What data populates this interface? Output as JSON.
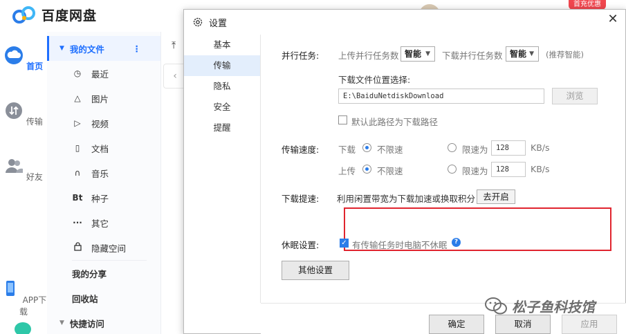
{
  "app": {
    "title": "百度网盘",
    "promo_badge": "首充优惠",
    "rail": [
      {
        "label": "首页",
        "icon": "cloud-icon",
        "active": true
      },
      {
        "label": "传输",
        "icon": "transfer-icon",
        "active": false
      },
      {
        "label": "好友",
        "icon": "friends-icon",
        "active": false
      },
      {
        "label": "APP下载",
        "icon": "phone-icon",
        "active": false
      }
    ],
    "nav": {
      "my_files": "我的文件",
      "items": [
        {
          "label": "最近",
          "icon": "clock-icon",
          "glyph": "◷"
        },
        {
          "label": "图片",
          "icon": "image-icon",
          "glyph": "△"
        },
        {
          "label": "视频",
          "icon": "video-icon",
          "glyph": "▷"
        },
        {
          "label": "文档",
          "icon": "document-icon",
          "glyph": "▯"
        },
        {
          "label": "音乐",
          "icon": "headphones-icon",
          "glyph": "∩"
        },
        {
          "label": "种子",
          "icon": "bt-icon",
          "glyph": "Bt"
        },
        {
          "label": "其它",
          "icon": "more-icon",
          "glyph": "···"
        },
        {
          "label": "隐藏空间",
          "icon": "lock-icon",
          "glyph": "🔒"
        }
      ],
      "my_share": "我的分享",
      "recycle": "回收站",
      "quick_access": "快捷访问"
    }
  },
  "dialog": {
    "title": "设置",
    "side_items": [
      {
        "label": "基本",
        "active": false
      },
      {
        "label": "传输",
        "active": true
      },
      {
        "label": "隐私",
        "active": false
      },
      {
        "label": "安全",
        "active": false
      },
      {
        "label": "提醒",
        "active": false
      }
    ],
    "parallel": {
      "label": "并行任务:",
      "upload_label": "上传并行任务数",
      "upload_value": "智能",
      "download_label": "下载并行任务数",
      "download_value": "智能",
      "hint": "(推荐智能)"
    },
    "download_location": {
      "label": "下载文件位置选择:",
      "path": "E:\\BaiduNetdiskDownload",
      "browse": "浏览",
      "default_checkbox": "默认此路径为下载路径",
      "default_checked": false
    },
    "speed": {
      "label": "传输速度:",
      "download_label": "下载",
      "upload_label": "上传",
      "unlimited": "不限速",
      "limit_to": "限速为",
      "download_limit": "128",
      "upload_limit": "128",
      "unit": "KB/s"
    },
    "accelerate": {
      "label": "下载提速:",
      "desc": "利用闲置带宽为下载加速或换取积分",
      "button": "去开启"
    },
    "sleep": {
      "label": "休眠设置:",
      "checkbox": "有传输任务时电脑不休眠",
      "checked": true
    },
    "other_settings": "其他设置",
    "footer": {
      "ok": "确定",
      "cancel": "取消",
      "apply": "应用"
    }
  },
  "watermark": "松子鱼科技馆"
}
